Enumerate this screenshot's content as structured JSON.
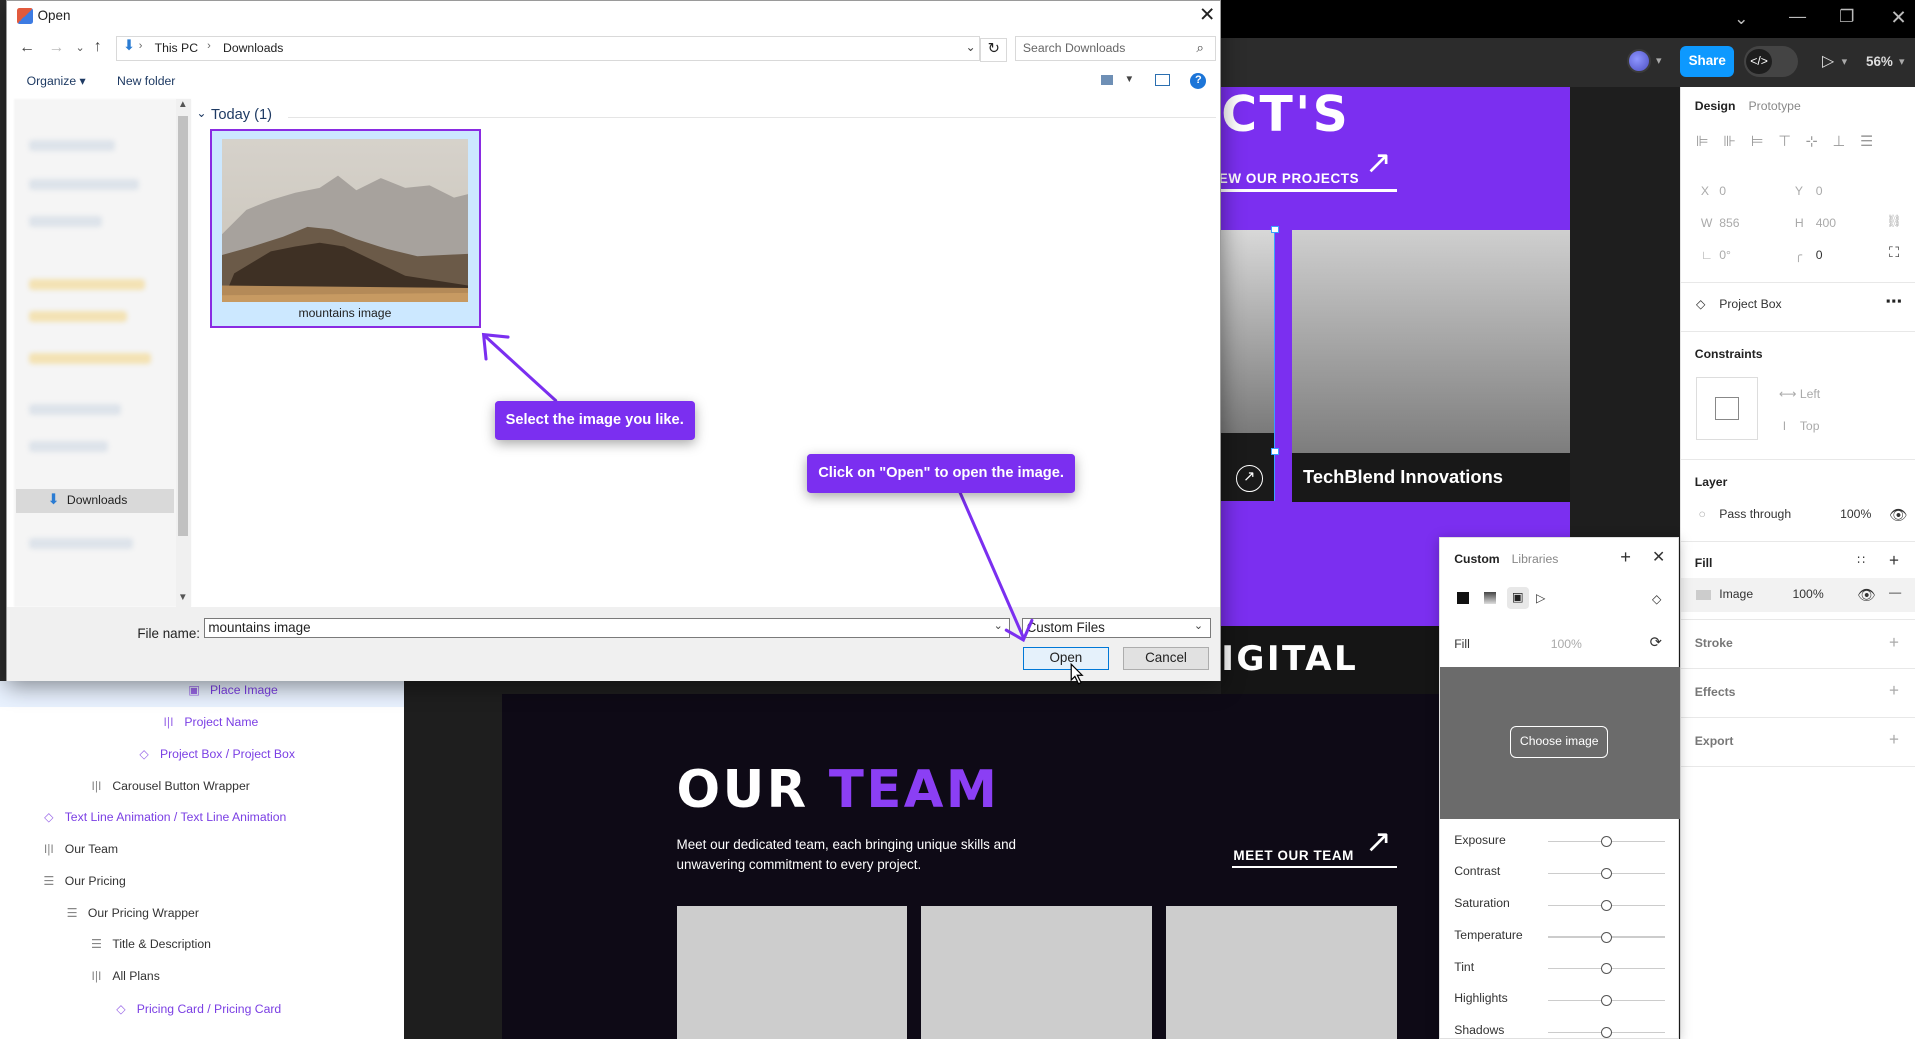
{
  "dialog": {
    "title": "Open",
    "breadcrumb": [
      "This PC",
      "Downloads"
    ],
    "search_placeholder": "Search Downloads",
    "organize": "Organize",
    "new_folder": "New folder",
    "group_header": "Today (1)",
    "nav_selected": "Downloads",
    "file": {
      "name": "mountains image"
    },
    "file_name_label": "File name:",
    "file_name_value": "mountains image",
    "filter": "Custom Files",
    "open_label": "Open",
    "cancel_label": "Cancel"
  },
  "callouts": {
    "select": "Select the image you like.",
    "open": "Click on \"Open\" to open the image."
  },
  "figma": {
    "share": "Share",
    "zoom": "56%",
    "canvas": {
      "heading_partial": "CT'S",
      "link": "EW OUR PROJECTS",
      "project_caption": "TechBlend Innovations",
      "digital_partial": "IGITAL",
      "team_word1": "OUR",
      "team_word2": "TEAM",
      "team_desc_1": "Meet our dedicated team, each bringing unique skills and",
      "team_desc_2": "unwavering commitment to every project.",
      "team_link": "MEET OUR TEAM"
    },
    "layers": [
      {
        "label": "Place Image"
      },
      {
        "label": "Project Name"
      },
      {
        "label": "Project Box / Project Box"
      },
      {
        "label": "Carousel Button Wrapper"
      },
      {
        "label": "Text Line Animation / Text Line Animation"
      },
      {
        "label": "Our Team"
      },
      {
        "label": "Our Pricing"
      },
      {
        "label": "Our Pricing Wrapper"
      },
      {
        "label": "Title & Description"
      },
      {
        "label": "All Plans"
      },
      {
        "label": "Pricing Card / Pricing Card"
      }
    ],
    "panel": {
      "tab_design": "Design",
      "tab_prototype": "Prototype",
      "x_label": "X",
      "x_value": "0",
      "y_label": "Y",
      "y_value": "0",
      "w_label": "W",
      "w_value": "856",
      "h_label": "H",
      "h_value": "400",
      "rotation": "0°",
      "radius": "0",
      "component": "Project Box",
      "constraints": "Constraints",
      "constraint_h": "Left",
      "constraint_v": "Top",
      "layer": "Layer",
      "blend": "Pass through",
      "opacity": "100%",
      "fill": "Fill",
      "fill_type": "Image",
      "fill_opacity": "100%",
      "stroke": "Stroke",
      "effects": "Effects",
      "export": "Export"
    },
    "picker": {
      "tab_custom": "Custom",
      "tab_libraries": "Libraries",
      "fill_label": "Fill",
      "fill_pct": "100%",
      "choose": "Choose image",
      "adjustments": [
        "Exposure",
        "Contrast",
        "Saturation",
        "Temperature",
        "Tint",
        "Highlights",
        "Shadows"
      ]
    }
  },
  "colors": {
    "accent": "#7b2ff0",
    "figma_blue": "#0d99ff",
    "win_blue": "#0078d7"
  }
}
